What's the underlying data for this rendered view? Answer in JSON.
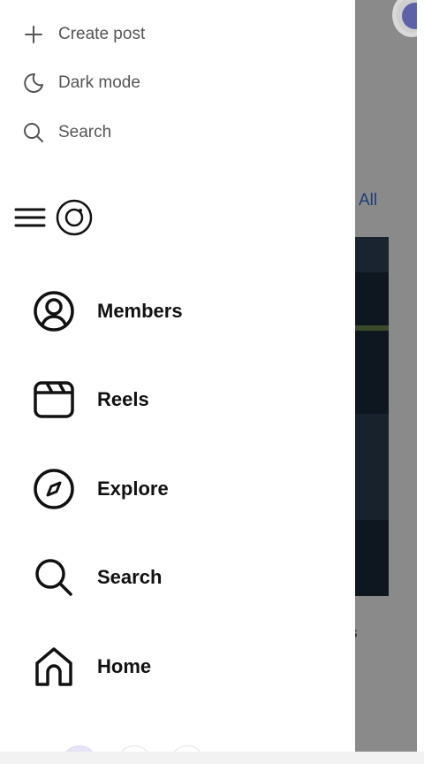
{
  "top_menu": {
    "items": [
      {
        "label": "Create post",
        "icon": "plus-icon"
      },
      {
        "label": "Dark mode",
        "icon": "moon-icon"
      },
      {
        "label": "Search",
        "icon": "search-icon"
      }
    ]
  },
  "nav": {
    "items": [
      {
        "label": "Members",
        "icon": "user-circle-icon"
      },
      {
        "label": "Reels",
        "icon": "reels-icon"
      },
      {
        "label": "Explore",
        "icon": "compass-icon"
      },
      {
        "label": "Search",
        "icon": "search-icon"
      },
      {
        "label": "Home",
        "icon": "home-icon"
      }
    ]
  },
  "background": {
    "filter_link": "All",
    "clipped_text": "s"
  },
  "colors": {
    "overlay": "#8a8a8a",
    "link": "#1b3f77",
    "avatar": "#5d62a8"
  }
}
